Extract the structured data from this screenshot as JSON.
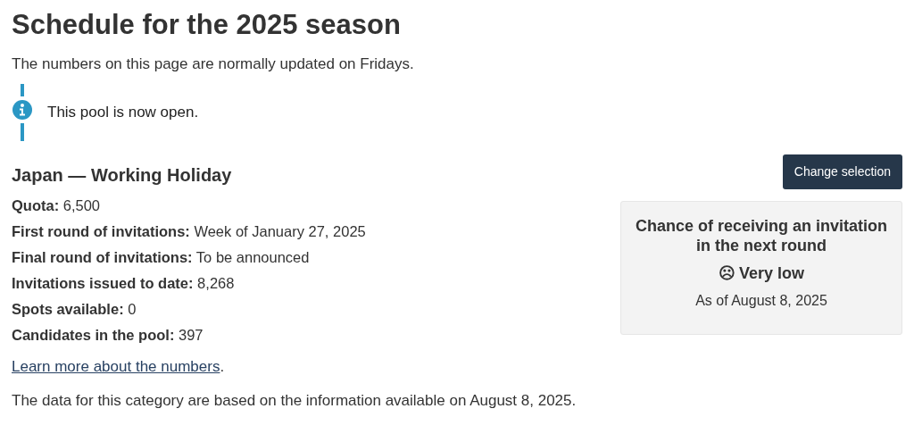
{
  "title": "Schedule for the 2025 season",
  "intro": "The numbers on this page are normally updated on Fridays.",
  "notice": {
    "kind": "info",
    "text": "This pool is now open."
  },
  "pool": {
    "heading": "Japan — Working Holiday",
    "stats": [
      "**Quota:** 6,500",
      "**First round of invitations:** Week of January 27, 2025",
      "**Final round of invitations:** To be announced",
      "**Invitations issued to date:** 8,268",
      "**Spots available:** 0",
      "**Candidates in the pool:** 397"
    ],
    "learn_more": {
      "link": "Learn more about the numbers",
      "suffix": "."
    },
    "note": "The data for this category are based on the information available on August 8, 2025."
  },
  "change_button": "Change selection",
  "chance": {
    "title": "Chance of receiving an invitation in the next round",
    "icon": "☹",
    "rating": "Very low",
    "as_of": "As of August 8, 2025"
  }
}
